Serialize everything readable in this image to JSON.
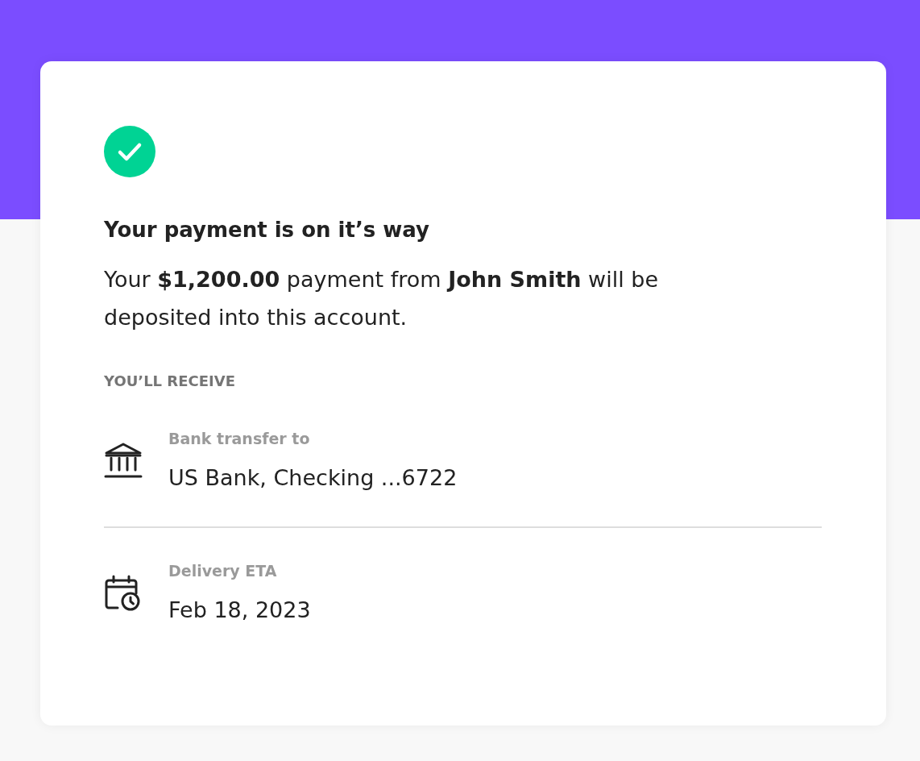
{
  "card": {
    "title": "Your payment is on it’s way",
    "message": "Your **$1,200.00** payment from **John Smith** will be deposited into this account.",
    "section_heading": "YOU’LL RECEIVE",
    "details": [
      {
        "kind": "bank",
        "label": "Bank transfer to",
        "value": "US Bank, Checking ...6722"
      },
      {
        "kind": "calendar",
        "label": "Delivery ETA",
        "value": "Feb 18, 2023"
      }
    ]
  }
}
